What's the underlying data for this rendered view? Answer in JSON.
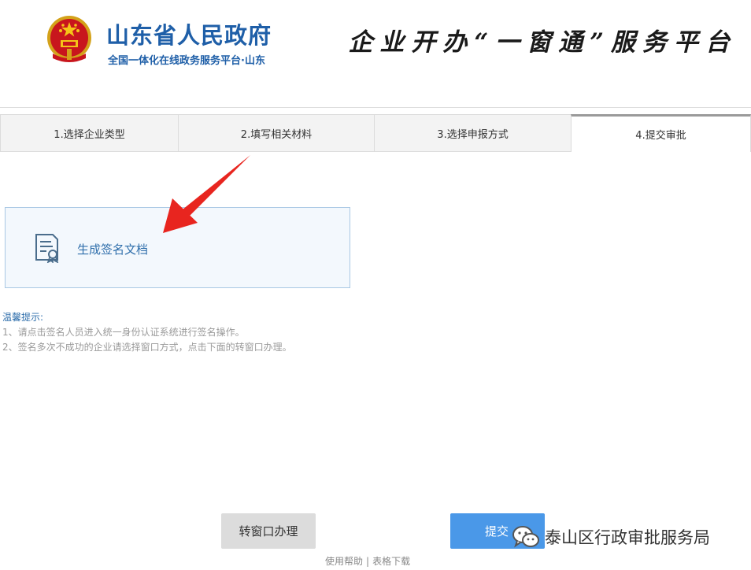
{
  "header": {
    "gov_name": "山东省人民政府",
    "gov_subtitle": "全国一体化在线政务服务平台·山东",
    "platform_title": "企业开办“一窗通”服务平台",
    "emblem_icon": "national-emblem-icon"
  },
  "steps": [
    {
      "label": "1.选择企业类型",
      "active": false
    },
    {
      "label": "2.填写相关材料",
      "active": false
    },
    {
      "label": "3.选择申报方式",
      "active": false
    },
    {
      "label": "4.提交审批",
      "active": true
    }
  ],
  "sign_box": {
    "label": "生成签名文档",
    "icon": "document-certificate-icon"
  },
  "tips": {
    "title": "温馨提示:",
    "lines": [
      "1、请点击签名人员进入统一身份认证系统进行签名操作。",
      "2、签名多次不成功的企业请选择窗口方式，点击下面的转窗口办理。"
    ]
  },
  "buttons": {
    "window_label": "转窗口办理",
    "submit_label": "提交"
  },
  "footer": {
    "help_link": "使用帮助",
    "separator": "|",
    "download_link": "表格下载"
  },
  "watermark": {
    "text": "泰山区行政审批服务局",
    "icon": "wechat-icon"
  },
  "colors": {
    "brand_blue": "#1f5fa8",
    "submit_blue": "#4a98e8",
    "arrow_red": "#e8251f"
  }
}
